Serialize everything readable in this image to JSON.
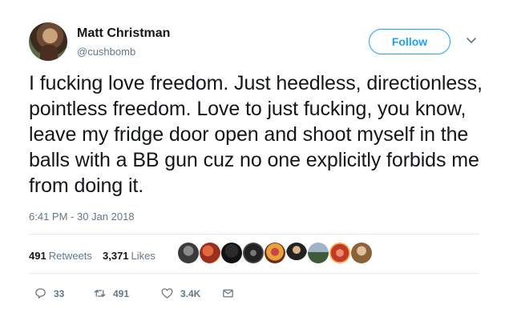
{
  "user": {
    "display_name": "Matt Christman",
    "handle": "@cushbomb"
  },
  "follow_label": "Follow",
  "tweet": {
    "text": "I fucking love freedom. Just heedless, directionless, pointless freedom. Love to just fucking, you know, leave my fridge door open and shoot myself in the balls with a BB gun cuz no one explicitly forbids me from doing it.",
    "timestamp": "6:41 PM - 30 Jan 2018"
  },
  "stats": {
    "retweets_count": "491",
    "retweets_label": "Retweets",
    "likes_count": "3,371",
    "likes_label": "Likes"
  },
  "actions": {
    "reply_count": "33",
    "retweet_count": "491",
    "like_count": "3.4K"
  },
  "colors": {
    "accent": "#1da1f2",
    "text": "#14171a",
    "muted": "#657786",
    "divider": "#e6ecf0"
  }
}
